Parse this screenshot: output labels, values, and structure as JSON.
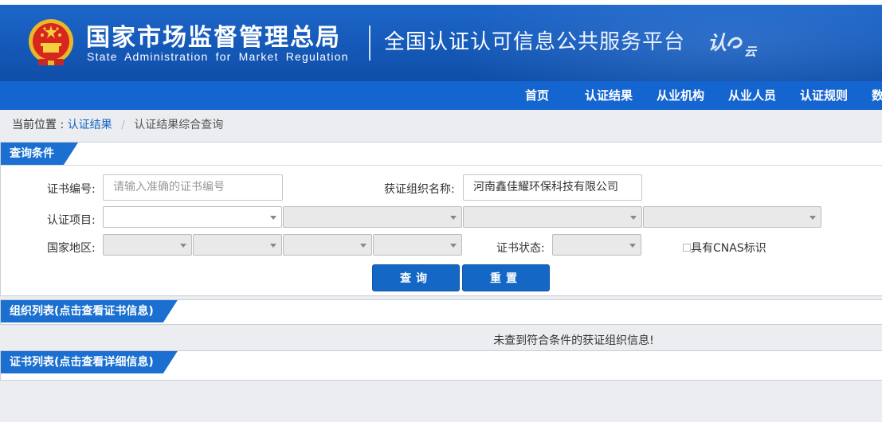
{
  "header": {
    "agency_cn": "国家市场监督管理总局",
    "agency_en": "State Administration for Market Regulation",
    "platform_title": "全国认证认可信息公共服务平台",
    "logo_main": "认",
    "logo_sub": "云"
  },
  "nav": {
    "items": [
      "首页",
      "认证结果",
      "从业机构",
      "从业人员",
      "认证规则",
      "数"
    ]
  },
  "breadcrumb": {
    "prefix": "当前位置 :",
    "link": "认证结果",
    "separator": "/",
    "current": "认证结果综合查询"
  },
  "query": {
    "title": "查询条件",
    "cert_no_label": "证书编号:",
    "cert_no_placeholder": "请输入准确的证书编号",
    "org_name_label": "获证组织名称:",
    "org_name_value": "河南鑫佳耀环保科技有限公司",
    "project_label": "认证项目:",
    "region_label": "国家地区:",
    "status_label": "证书状态:",
    "cnas_label": "具有CNAS标识",
    "search_button": "查询",
    "reset_button": "重置"
  },
  "org_list": {
    "title": "组织列表(点击查看证书信息)",
    "empty_message": "未查到符合条件的获证组织信息!"
  },
  "cert_list": {
    "title": "证书列表(点击查看详细信息)"
  },
  "colors": {
    "header_blue": "#1559b8",
    "nav_blue": "#1565d0",
    "tab_blue": "#1a6fd0",
    "button_blue": "#1467c4"
  }
}
